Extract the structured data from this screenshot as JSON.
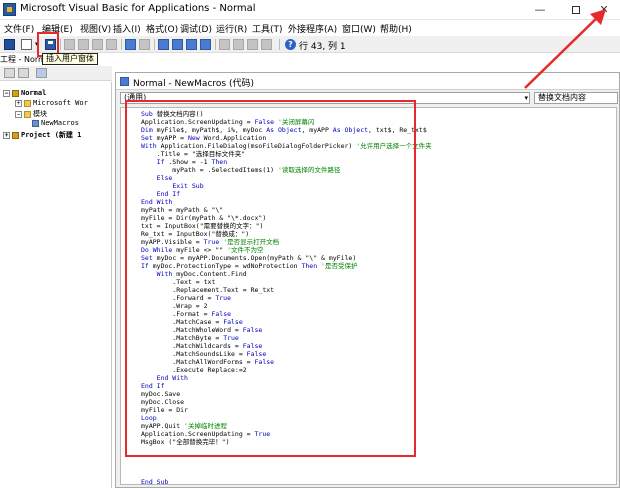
{
  "window": {
    "title": "Microsoft Visual Basic for Applications - Normal",
    "minimize": "—",
    "close": "✕"
  },
  "menu": [
    "文件(F)",
    "编辑(E)",
    "视图(V)",
    "插入(I)",
    "格式(O)",
    "调试(D)",
    "运行(R)",
    "工具(T)",
    "外接程序(A)",
    "窗口(W)",
    "帮助(H)"
  ],
  "toolbar": {
    "tooltip": "插入用户窗体",
    "help": "?",
    "cursor_position": "行 43, 列 1"
  },
  "project": {
    "title": "工程 - Norm",
    "tree": [
      {
        "toggle": "−",
        "icon": "book",
        "label": "Normal",
        "bold": true
      },
      {
        "toggle": "+",
        "icon": "folder",
        "label": "Microsoft Wor"
      },
      {
        "toggle": "−",
        "icon": "folder",
        "label": "模块"
      },
      {
        "toggle": "",
        "icon": "module",
        "label": "NewMacros"
      },
      {
        "toggle": "+",
        "icon": "book",
        "label": "Project (新建 1",
        "bold": true
      }
    ]
  },
  "code_window": {
    "title": "Normal - NewMacros (代码)",
    "object_combo": "(通用)",
    "proc_combo": "替换文档内容"
  },
  "code": [
    "Sub 替换文档内容()",
    "Application.ScreenUpdating = False '关闭屏幕闪",
    "Dim myFile$, myPath$, i%, myDoc As Object, myAPP As Object, txt$, Re_txt$",
    "Set myAPP = New Word.Application",
    "With Application.FileDialog(msoFileDialogFolderPicker) '允许用户选择一个文件夹",
    "    .Title = \"选择目标文件夹\"",
    "    If .Show = -1 Then",
    "        myPath = .SelectedItems(1) '读取选择的文件路径",
    "    Else",
    "        Exit Sub",
    "    End If",
    "End With",
    "myPath = myPath & \"\\\"",
    "myFile = Dir(myPath & \"\\*.docx\")",
    "txt = InputBox(\"需要替换的文字：\")",
    "Re_txt = InputBox(\"替换成：\")",
    "myAPP.Visible = True '是否显示打开文档",
    "Do While myFile <> \"\" '文件不为空",
    "Set myDoc = myAPP.Documents.Open(myPath & \"\\\" & myFile)",
    "If myDoc.ProtectionType = wdNoProtection Then '是否受保护",
    "    With myDoc.Content.Find",
    "        .Text = txt",
    "        .Replacement.Text = Re_txt",
    "        .Forward = True",
    "        .Wrap = 2",
    "        .Format = False",
    "        .MatchCase = False",
    "        .MatchWholeWord = False",
    "        .MatchByte = True",
    "        .MatchWildcards = False",
    "        .MatchSoundsLike = False",
    "        .MatchAllWordForms = False",
    "        .Execute Replace:=2",
    "    End With",
    "End If",
    "myDoc.Save",
    "myDoc.Close",
    "myFile = Dir",
    "Loop",
    "myAPP.Quit '关掉临时进程",
    "Application.ScreenUpdating = True",
    "MsgBox (\"全部替换完毕！\")",
    "",
    "",
    "",
    "",
    "End Sub"
  ],
  "colors": {
    "annotation": "#e8292c",
    "keyword": "#0000c0",
    "comment": "#008000"
  }
}
